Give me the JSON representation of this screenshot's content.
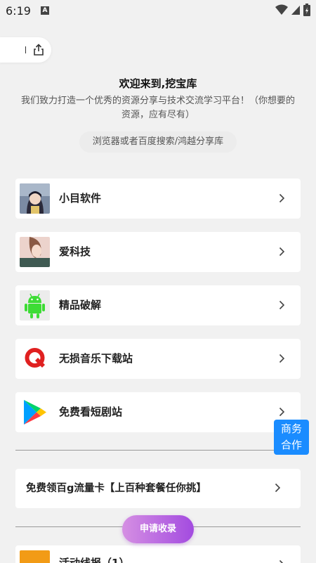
{
  "status": {
    "time": "6:19",
    "notif": "A"
  },
  "header": {
    "title": "欢迎来到,挖宝库",
    "description": "我们致力打造一个优秀的资源分享与技术交流学习平台！（你想要的资源，应有尽有）",
    "search_hint": "浏览器或者百度搜索/鸿越分享库"
  },
  "sites": [
    {
      "label": "小目软件",
      "icon": "anime-avatar-icon"
    },
    {
      "label": "爱科技",
      "icon": "portrait-photo-icon"
    },
    {
      "label": "精品破解",
      "icon": "android-robot-icon"
    },
    {
      "label": "无损音乐下载站",
      "icon": "red-q-logo-icon"
    },
    {
      "label": "免费看短剧站",
      "icon": "play-store-icon"
    }
  ],
  "promo": {
    "label": "免费领百g流量卡【上百种套餐任你挑】"
  },
  "business_button": {
    "line1": "商务",
    "line2": "合作"
  },
  "apply_button": {
    "label": "申请收录"
  },
  "partial_item": {
    "label": "活动线报（1）"
  },
  "colors": {
    "accent_blue": "#1a8cff",
    "apply_gradient_start": "#d58fe3",
    "apply_gradient_end": "#a34be0"
  }
}
